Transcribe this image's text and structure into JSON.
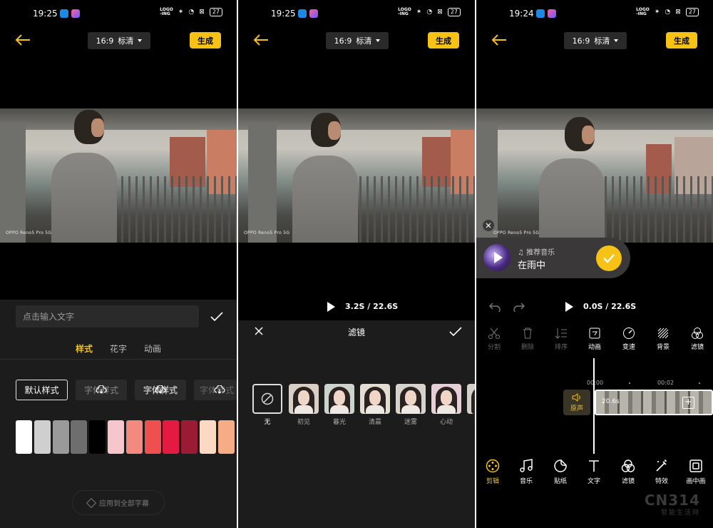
{
  "status": {
    "p1_time": "19:25",
    "p2_time": "19:25",
    "p3_time": "19:24",
    "logo_top": "LOGO",
    "logo_bottom": "-ING",
    "battery": "27"
  },
  "topbar": {
    "ratio": "16:9",
    "quality": "标清",
    "generate": "生成"
  },
  "video": {
    "watermark": "OPPO Reno5 Pro 5G"
  },
  "text_panel": {
    "input_placeholder": "点击输入文字",
    "tabs": [
      "样式",
      "花字",
      "动画"
    ],
    "styles": [
      "默认样式",
      "字体样式",
      "字体样式",
      "字体样式"
    ],
    "swatches": [
      "#ffffff",
      "#cfcfcf",
      "#9a9a9a",
      "#6e6e6e",
      "#000000",
      "#f6c6cc",
      "#f28a80",
      "#f04f4f",
      "#e51a43",
      "#9a1b33",
      "#fbd9c2",
      "#f6ad85"
    ],
    "apply_all": "应用到全部字幕"
  },
  "filter_panel": {
    "time": "3.2S / 22.6S",
    "title": "滤镜",
    "filters": [
      "无",
      "初见",
      "暮光",
      "清晨",
      "迷雾",
      "心动"
    ]
  },
  "edit_panel": {
    "time": "0.0S / 22.6S",
    "music_label": "推荐音乐",
    "music_song": "在雨中",
    "tools": [
      "分割",
      "删除",
      "排序",
      "动画",
      "变速",
      "背景",
      "滤镜"
    ],
    "timeline_ticks": [
      "00:00",
      "00:02"
    ],
    "original_sound": "原声",
    "clip_duration": "20.6s",
    "nav": [
      "剪辑",
      "音乐",
      "贴纸",
      "文字",
      "滤镜",
      "特效",
      "画中画"
    ],
    "brand_top": "CN314",
    "brand_bottom": "智能生活网"
  },
  "colors": {
    "accent": "#f5c215",
    "sheet": "#1c1c1c"
  }
}
